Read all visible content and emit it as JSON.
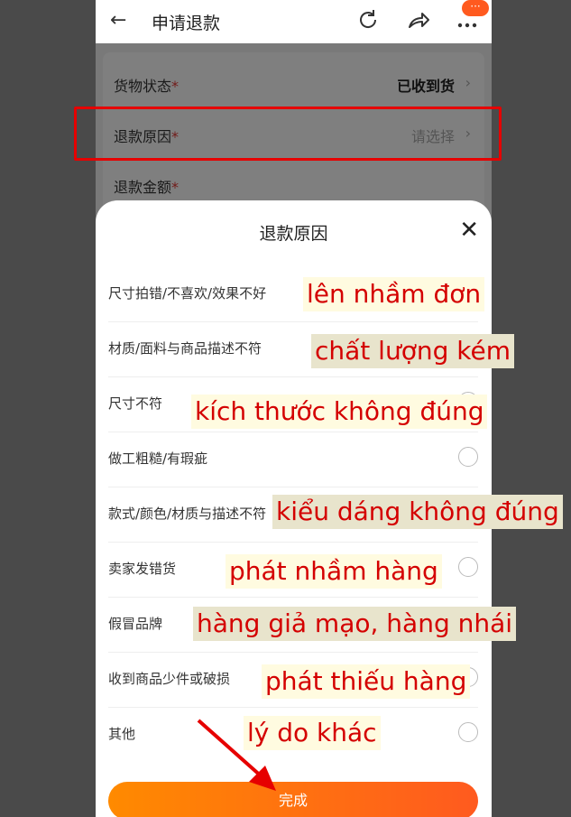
{
  "header": {
    "title": "申请退款",
    "badge": "···"
  },
  "form": {
    "goods_status_label": "货物状态",
    "goods_status_value": "已收到货",
    "refund_reason_label": "退款原因",
    "refund_reason_placeholder": "请选择",
    "refund_amount_label": "退款金额",
    "required_mark": "*"
  },
  "sheet": {
    "title": "退款原因",
    "options": [
      "尺寸拍错/不喜欢/效果不好",
      "材质/面料与商品描述不符",
      "尺寸不符",
      "做工粗糙/有瑕疵",
      "款式/颜色/材质与描述不符",
      "卖家发错货",
      "假冒品牌",
      "收到商品少件或破损",
      "其他"
    ],
    "done_label": "完成"
  },
  "annotations": [
    "lên nhầm đơn",
    "chất lượng kém",
    "kích thước không đúng",
    "kiểu dáng không đúng",
    "phát nhầm hàng",
    "hàng giả mạo, hàng nhái",
    "phát thiếu hàng",
    "lý do khác"
  ],
  "colors": {
    "accent": "#ff6a00",
    "annotation_red": "#d40000",
    "highlight_red": "#e60000"
  }
}
